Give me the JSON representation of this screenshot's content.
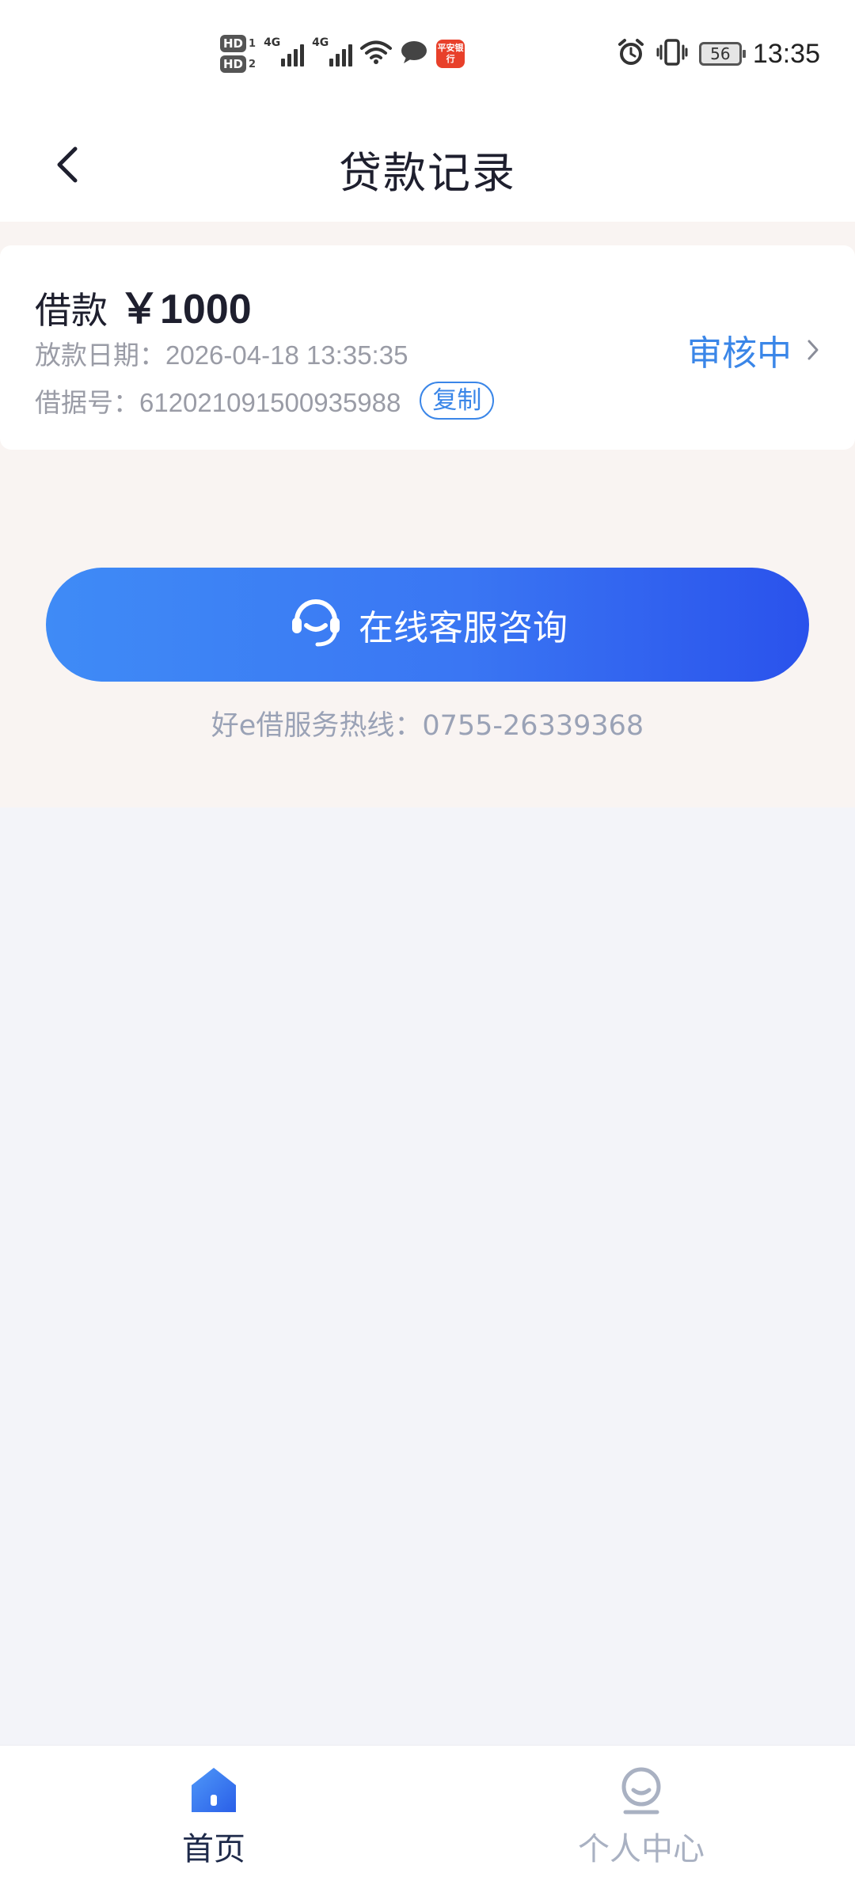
{
  "status_bar": {
    "hd1": "HD",
    "hd1_sub": "1",
    "hd2": "HD",
    "hd2_sub": "2",
    "network1": "4G",
    "network2": "4G",
    "app_icon_text": "平安银行",
    "battery": "56",
    "time": "13:35"
  },
  "nav": {
    "title": "贷款记录",
    "back_icon": "chevron-left-icon"
  },
  "loan": {
    "label": "借款",
    "amount": "￥1000",
    "date_text": "放款日期：2026-04-18 13:35:35",
    "number_text": "借据号：612021091500935988",
    "copy_label": "复制",
    "status": "审核中"
  },
  "service": {
    "button_label": "在线客服咨询",
    "hotline_text": "好e借服务热线：0755-26339368"
  },
  "tabs": [
    {
      "label": "首页",
      "icon": "home-icon",
      "active": true
    },
    {
      "label": "个人中心",
      "icon": "user-icon",
      "active": false
    }
  ],
  "colors": {
    "accent": "#3a86e8",
    "button_start": "#3f8bf6",
    "button_end": "#2a52ec",
    "page_bg": "#f3f4f9",
    "content_bg": "#f9f4f2"
  }
}
